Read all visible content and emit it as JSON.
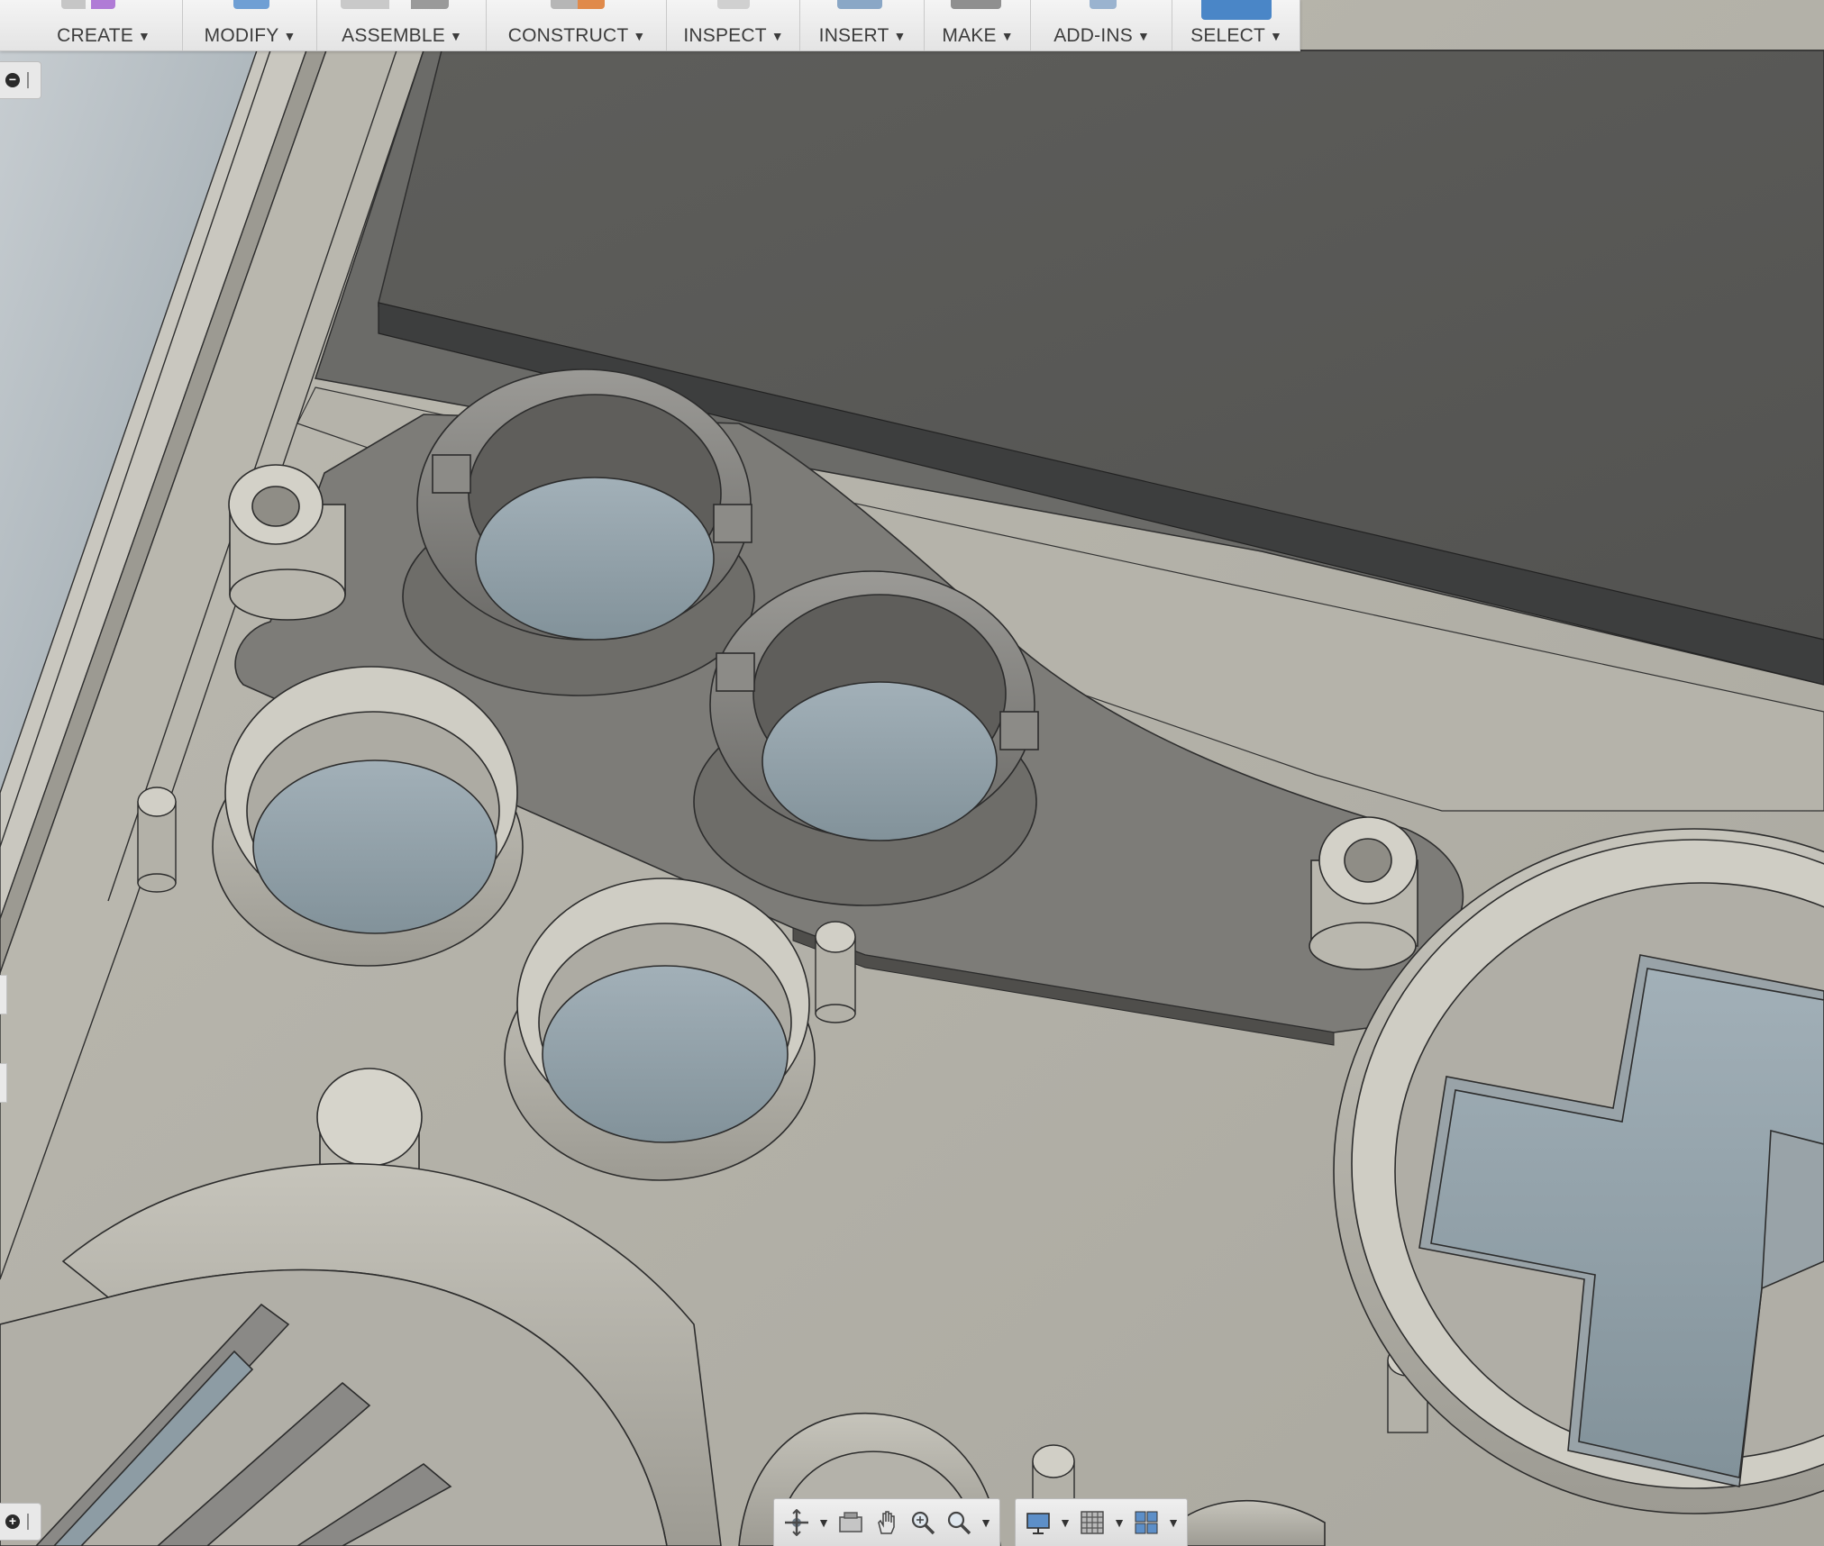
{
  "toolbar": {
    "groups": [
      {
        "label": "CREATE",
        "icon": "create-sketch-icon"
      },
      {
        "label": "MODIFY",
        "icon": "modify-icon"
      },
      {
        "label": "ASSEMBLE",
        "icon": "assemble-joint-icon"
      },
      {
        "label": "CONSTRUCT",
        "icon": "construct-plane-icon"
      },
      {
        "label": "INSPECT",
        "icon": "inspect-measure-icon"
      },
      {
        "label": "INSERT",
        "icon": "insert-image-icon"
      },
      {
        "label": "MAKE",
        "icon": "make-3d-print-icon"
      },
      {
        "label": "ADD-INS",
        "icon": "add-ins-gear-icon"
      },
      {
        "label": "SELECT",
        "icon": "select-cursor-icon",
        "active": true
      }
    ],
    "caret": "▼"
  },
  "browser_toggle": {
    "minus": "−",
    "plus": "+"
  },
  "navbar": {
    "tools": [
      "orbit-icon",
      "look-at-icon",
      "pan-icon",
      "zoom-icon",
      "fit-icon",
      "display-settings-icon",
      "grid-settings-icon",
      "viewports-icon"
    ],
    "caret": "▼"
  },
  "colors": {
    "toolbar_bg": "#ececec",
    "selection_blue": "#4a86c7",
    "body_light": "#bdbbb2",
    "body_dark": "#74736f",
    "screen": "#5b5b58",
    "hole_blue": "#8d9ca4"
  }
}
